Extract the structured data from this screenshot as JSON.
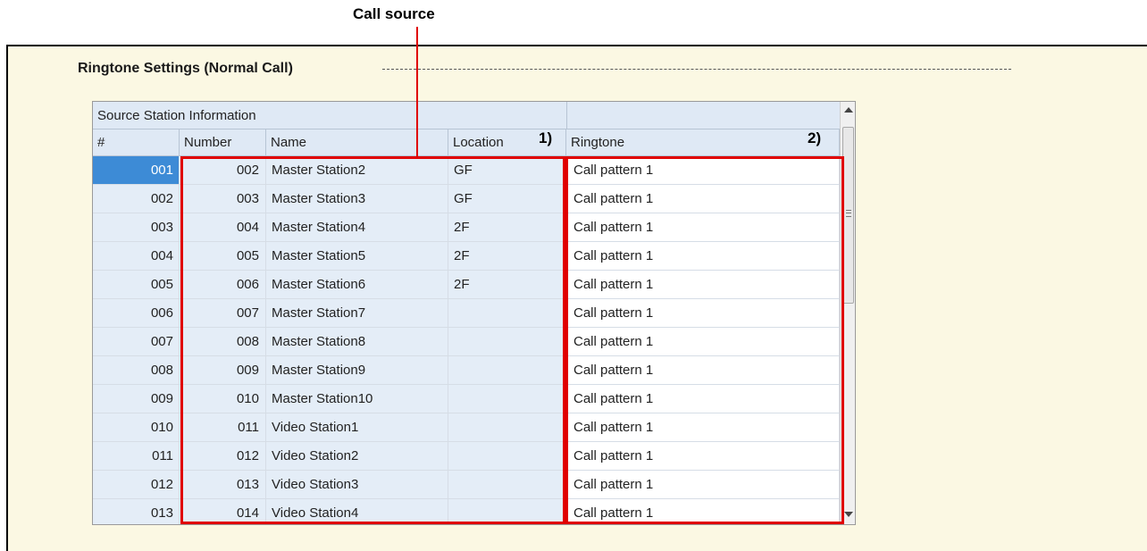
{
  "callout": {
    "label": "Call source",
    "marker1": "1)",
    "marker2": "2)"
  },
  "section": {
    "title": "Ringtone Settings (Normal Call)"
  },
  "table": {
    "group_header": "Source Station Information",
    "columns": {
      "idx": "#",
      "number": "Number",
      "name": "Name",
      "location": "Location",
      "ringtone": "Ringtone"
    },
    "rows": [
      {
        "idx": "001",
        "number": "002",
        "name": "Master Station2",
        "location": "GF",
        "ringtone": "Call pattern 1"
      },
      {
        "idx": "002",
        "number": "003",
        "name": "Master Station3",
        "location": "GF",
        "ringtone": "Call pattern 1"
      },
      {
        "idx": "003",
        "number": "004",
        "name": "Master Station4",
        "location": "2F",
        "ringtone": "Call pattern 1"
      },
      {
        "idx": "004",
        "number": "005",
        "name": "Master Station5",
        "location": "2F",
        "ringtone": "Call pattern 1"
      },
      {
        "idx": "005",
        "number": "006",
        "name": "Master Station6",
        "location": "2F",
        "ringtone": "Call pattern 1"
      },
      {
        "idx": "006",
        "number": "007",
        "name": "Master Station7",
        "location": "",
        "ringtone": "Call pattern 1"
      },
      {
        "idx": "007",
        "number": "008",
        "name": "Master Station8",
        "location": "",
        "ringtone": "Call pattern 1"
      },
      {
        "idx": "008",
        "number": "009",
        "name": "Master Station9",
        "location": "",
        "ringtone": "Call pattern 1"
      },
      {
        "idx": "009",
        "number": "010",
        "name": "Master Station10",
        "location": "",
        "ringtone": "Call pattern 1"
      },
      {
        "idx": "010",
        "number": "011",
        "name": "Video Station1",
        "location": "",
        "ringtone": "Call pattern 1"
      },
      {
        "idx": "011",
        "number": "012",
        "name": "Video Station2",
        "location": "",
        "ringtone": "Call pattern 1"
      },
      {
        "idx": "012",
        "number": "013",
        "name": "Video Station3",
        "location": "",
        "ringtone": "Call pattern 1"
      },
      {
        "idx": "013",
        "number": "014",
        "name": "Video Station4",
        "location": "",
        "ringtone": "Call pattern 1"
      }
    ],
    "selected_row": "001"
  },
  "icons": {
    "scroll_up": "scroll-up-arrow-icon",
    "scroll_down": "scroll-down-arrow-icon",
    "grip": "scrollbar-grip-icon"
  },
  "colors": {
    "callout_red": "#e00000",
    "selected_blue": "#3d8bd6",
    "panel_bg": "#fbf8e3",
    "cell_bg": "#e4edf7"
  }
}
